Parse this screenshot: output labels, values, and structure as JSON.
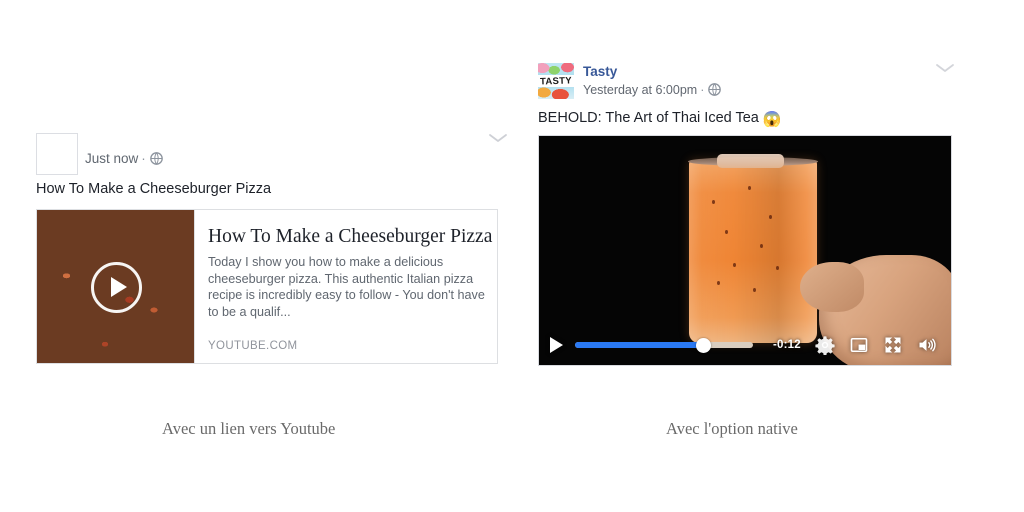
{
  "posts": {
    "left": {
      "author_placeholder": "",
      "timestamp": "Just now",
      "separator": "·",
      "privacy_icon": "globe-icon",
      "message": "How To Make a Cheeseburger Pizza",
      "menu_icon": "chevron-down-icon",
      "link_card": {
        "title": "How To Make a Cheeseburger Pizza",
        "description": "Today I show you how to make a delicious cheeseburger pizza. This authentic Italian pizza recipe is incredibly easy to follow - You don't have to be a qualif...",
        "domain": "YOUTUBE.COM",
        "thumbnail_alt": "pizza-thumbnail",
        "play_icon": "play-icon"
      }
    },
    "right": {
      "author": "Tasty",
      "avatar_text": "TASTY",
      "timestamp": "Yesterday at 6:00pm",
      "separator": "·",
      "privacy_icon": "globe-icon",
      "message": "BEHOLD: The Art of Thai Iced Tea",
      "message_emoji": "😱",
      "menu_icon": "chevron-down-icon",
      "video": {
        "alt": "thai-iced-tea-video",
        "play_icon": "play-icon",
        "time_remaining": "-0:12",
        "progress_percent": 72,
        "settings_icon": "gear-icon",
        "pip_icon": "picture-in-picture-icon",
        "fullscreen_icon": "fullscreen-icon",
        "volume_icon": "volume-on-icon"
      }
    }
  },
  "captions": {
    "left": "Avec un lien vers Youtube",
    "right": "Avec l'option native"
  },
  "colors": {
    "accent_blue": "#2a79f3",
    "author_link": "#385898",
    "text_primary": "#1d2129",
    "text_secondary": "#606770",
    "caption": "#6a6a6a",
    "card_border": "#dddfe2"
  }
}
